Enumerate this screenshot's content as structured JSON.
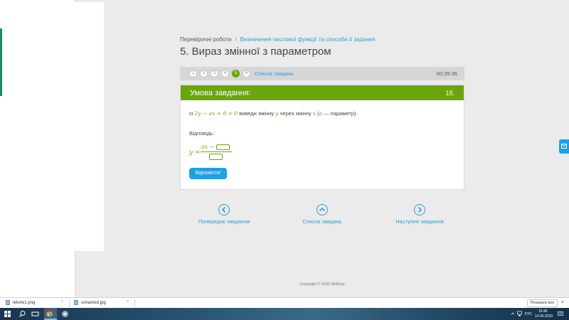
{
  "breadcrumb": {
    "root": "Перевірочні роботи",
    "separator": "/",
    "current": "Визначення числової функції та способи її задання"
  },
  "page_title": "5. Вираз змінної з параметром",
  "task_nav": {
    "numbers": [
      "1",
      "2",
      "3",
      "4",
      "5",
      "6"
    ],
    "active_number": "5",
    "list_link": "Список завдань",
    "timer": "00:25:36"
  },
  "task": {
    "header": "Умова завдання:",
    "points": "1б.",
    "text_prefix": "Із",
    "equation": "2y − ax + 8 = 0",
    "text_mid1": "виведи змінну",
    "var_y": "y",
    "text_mid2": "через змінну",
    "var_x": "x",
    "paren_open": "(",
    "param": "a",
    "text_end": "— параметр).",
    "answer_label": "Відповідь:",
    "formula_lhs": "y =",
    "formula_num": "ax −",
    "submit_label": "Відповісти!"
  },
  "bottom_nav": {
    "prev": "Попереднє завдання",
    "list": "Список завдань",
    "next": "Наступне завдання"
  },
  "copyright": "Copyright © 2020 MiliKlas",
  "downloads": {
    "items": [
      "telone1.png",
      "unnamed.jpg"
    ],
    "show_all": "Показати все",
    "close_icon": "×"
  },
  "taskbar": {
    "lang": "РУС",
    "time": "15:46",
    "date": "14.05.2020"
  },
  "colors": {
    "accent_green": "#6aa50c",
    "link_blue": "#2a9fd6",
    "button_blue": "#1e9fe6"
  },
  "icons": [
    "windows-start-icon",
    "search-icon",
    "task-view-icon",
    "chrome-icon",
    "app-icon",
    "chevron-left-icon",
    "chevron-up-icon",
    "chevron-right-icon",
    "mail-icon",
    "file-icon",
    "chevron-up-icon"
  ]
}
